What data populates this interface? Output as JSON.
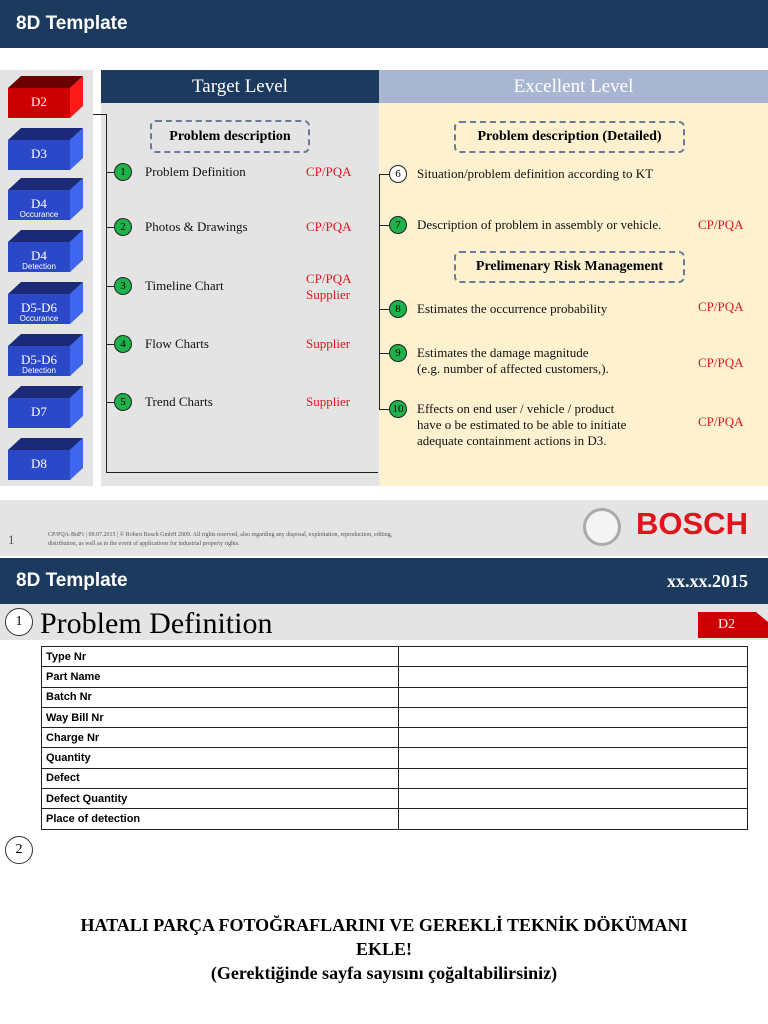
{
  "slide1": {
    "title": "8D Template",
    "steps": [
      {
        "label": "D2",
        "sub": ""
      },
      {
        "label": "D3",
        "sub": ""
      },
      {
        "label": "D4",
        "sub": "Occurance"
      },
      {
        "label": "D4",
        "sub": "Detection"
      },
      {
        "label": "D5-D6",
        "sub": "Occurance"
      },
      {
        "label": "D5-D6",
        "sub": "Detection"
      },
      {
        "label": "D7",
        "sub": ""
      },
      {
        "label": "D8",
        "sub": ""
      }
    ],
    "target": {
      "header": "Target Level",
      "box": "Problem description",
      "items": [
        {
          "n": "1",
          "label": "Problem Definition",
          "owner": "CP/PQA"
        },
        {
          "n": "2",
          "label": "Photos & Drawings",
          "owner": "CP/PQA"
        },
        {
          "n": "3",
          "label": "Timeline Chart",
          "owner": "CP/PQA",
          "owner2": "Supplier"
        },
        {
          "n": "4",
          "label": "Flow  Charts",
          "owner": "Supplier"
        },
        {
          "n": "5",
          "label": "Trend Charts",
          "owner": "Supplier"
        }
      ]
    },
    "excellent": {
      "header": "Excellent Level",
      "box": "Problem description (Detailed)",
      "box2": "Prelimenary Risk Management",
      "items": [
        {
          "n": "6",
          "label": "Situation/problem definition according to KT",
          "owner": ""
        },
        {
          "n": "7",
          "label": "Description of problem in assembly or vehicle.",
          "owner": "CP/PQA"
        },
        {
          "n": "8",
          "label": "Estimates the occurrence probability",
          "owner": "CP/PQA"
        },
        {
          "n": "9",
          "label": "Estimates the damage magnitude",
          "label2": "(e.g. number of affected customers,).",
          "owner": "CP/PQA"
        },
        {
          "n": "10",
          "label": "Effects on end user / vehicle / product",
          "label2": "have o be estimated to be able to initiate",
          "label3": "adequate containment actions in D3.",
          "owner": "CP/PQA"
        }
      ]
    },
    "footer": {
      "page": "1",
      "text1": "CP/PQA-BuP1 | 09.07.2015 | © Robert Bosch GmbH 2009. All rights reserved, also regarding any disposal, exploitation, reproduction, editing,",
      "text2": "distribution, as well as in the event of applications for industrial property rights.",
      "brand": "BOSCH"
    }
  },
  "slide2": {
    "title": "8D Template",
    "date": "xx.xx.2015",
    "n1": "1",
    "heading": "Problem Definition",
    "badge": "D2",
    "rows": [
      "Type Nr",
      "Part Name",
      "Batch Nr",
      "Way Bill Nr",
      "Charge Nr",
      "Quantity",
      "Defect",
      "Defect Quantity",
      "Place of detection"
    ],
    "n2": "2",
    "notice1": "HATALI PARÇA FOTOĞRAFLARINI VE GEREKLİ TEKNİK DÖKÜMANI",
    "notice2": "EKLE!",
    "notice3": "(Gerektiğinde sayfa sayısını çoğaltabilirsiniz)"
  }
}
